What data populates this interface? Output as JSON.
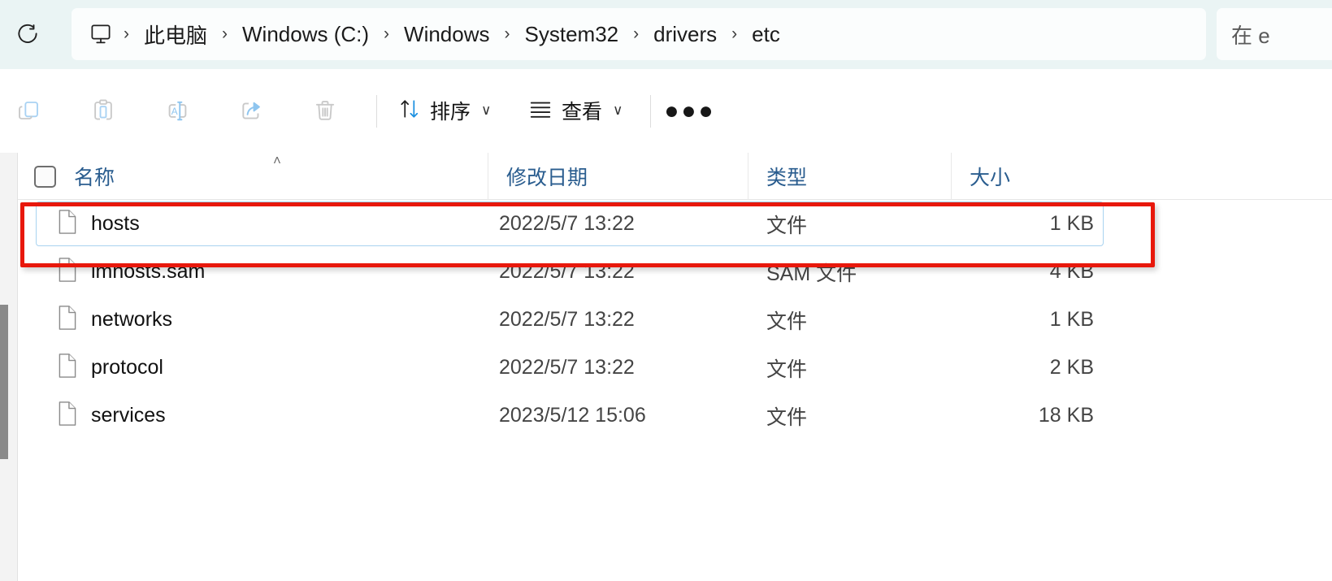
{
  "window": {
    "background_color": "#eaf4f4",
    "content_background": "#ffffff"
  },
  "navbar": {
    "refresh_icon": "refresh-icon",
    "pc_icon": "this-pc-monitor-icon",
    "breadcrumbs": [
      {
        "label": "此电脑"
      },
      {
        "label": "Windows (C:)"
      },
      {
        "label": "Windows"
      },
      {
        "label": "System32"
      },
      {
        "label": "drivers"
      },
      {
        "label": "etc"
      }
    ],
    "separator_glyph": "›",
    "search": {
      "placeholder": "在 e",
      "icon": "search-icon"
    }
  },
  "toolbar": {
    "icons": [
      {
        "name": "copy-icon",
        "label": "复制"
      },
      {
        "name": "paste-icon",
        "label": "粘贴"
      },
      {
        "name": "rename-icon",
        "label": "重命名"
      },
      {
        "name": "share-icon",
        "label": "共享"
      },
      {
        "name": "delete-icon",
        "label": "删除"
      }
    ],
    "sort": {
      "label": "排序",
      "icon": "sort-arrows-icon",
      "chevron": "∨"
    },
    "view": {
      "label": "查看",
      "icon": "view-list-icon",
      "chevron": "∨"
    },
    "more_label": "●●●"
  },
  "filelist": {
    "select_all_checkbox": false,
    "sort_indicator": "˄",
    "columns": [
      {
        "key": "name",
        "label": "名称"
      },
      {
        "key": "date",
        "label": "修改日期"
      },
      {
        "key": "type",
        "label": "类型"
      },
      {
        "key": "size",
        "label": "大小"
      }
    ],
    "rows": [
      {
        "name": "hosts",
        "date": "2022/5/7 13:22",
        "type": "文件",
        "size": "1 KB",
        "icon": "file-document-icon",
        "selected": true,
        "annotated": true
      },
      {
        "name": "lmhosts.sam",
        "date": "2022/5/7 13:22",
        "type": "SAM 文件",
        "size": "4 KB",
        "icon": "file-document-icon",
        "selected": false,
        "annotated": false
      },
      {
        "name": "networks",
        "date": "2022/5/7 13:22",
        "type": "文件",
        "size": "1 KB",
        "icon": "file-document-icon",
        "selected": false,
        "annotated": false
      },
      {
        "name": "protocol",
        "date": "2022/5/7 13:22",
        "type": "文件",
        "size": "2 KB",
        "icon": "file-document-icon",
        "selected": false,
        "annotated": false
      },
      {
        "name": "services",
        "date": "2023/5/12 15:06",
        "type": "文件",
        "size": "18 KB",
        "icon": "file-document-icon",
        "selected": false,
        "annotated": false
      }
    ]
  },
  "annotation": {
    "color": "#e8180c",
    "target": "hosts"
  }
}
